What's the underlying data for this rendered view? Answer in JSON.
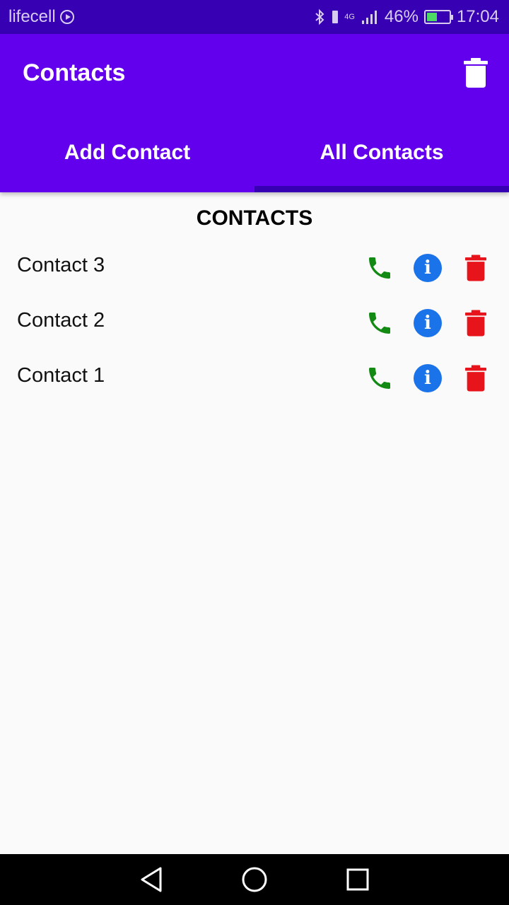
{
  "status_bar": {
    "carrier": "lifecell",
    "network": "4G",
    "battery_percent": "46%",
    "battery_level": 0.46,
    "time": "17:04",
    "icons": [
      "bluetooth-icon",
      "signal-icon",
      "battery-icon"
    ]
  },
  "app_bar": {
    "title": "Contacts",
    "action_icon": "trash-icon"
  },
  "tabs": [
    {
      "label": "Add Contact",
      "active": false
    },
    {
      "label": "All Contacts",
      "active": true
    }
  ],
  "list": {
    "header": "CONTACTS",
    "contacts": [
      {
        "name": "Contact 3"
      },
      {
        "name": "Contact 2"
      },
      {
        "name": "Contact 1"
      }
    ],
    "row_icons": [
      "phone-icon",
      "info-icon",
      "trash-icon"
    ]
  },
  "nav_bar": {
    "icons": [
      "back-icon",
      "home-icon",
      "recents-icon"
    ]
  },
  "colors": {
    "status_bar": "#3700b3",
    "app_bar": "#6200ee",
    "tab_indicator": "#3700b3",
    "call": "#138a13",
    "info": "#1a73e8",
    "delete": "#e8141b",
    "background": "#fafafa"
  }
}
